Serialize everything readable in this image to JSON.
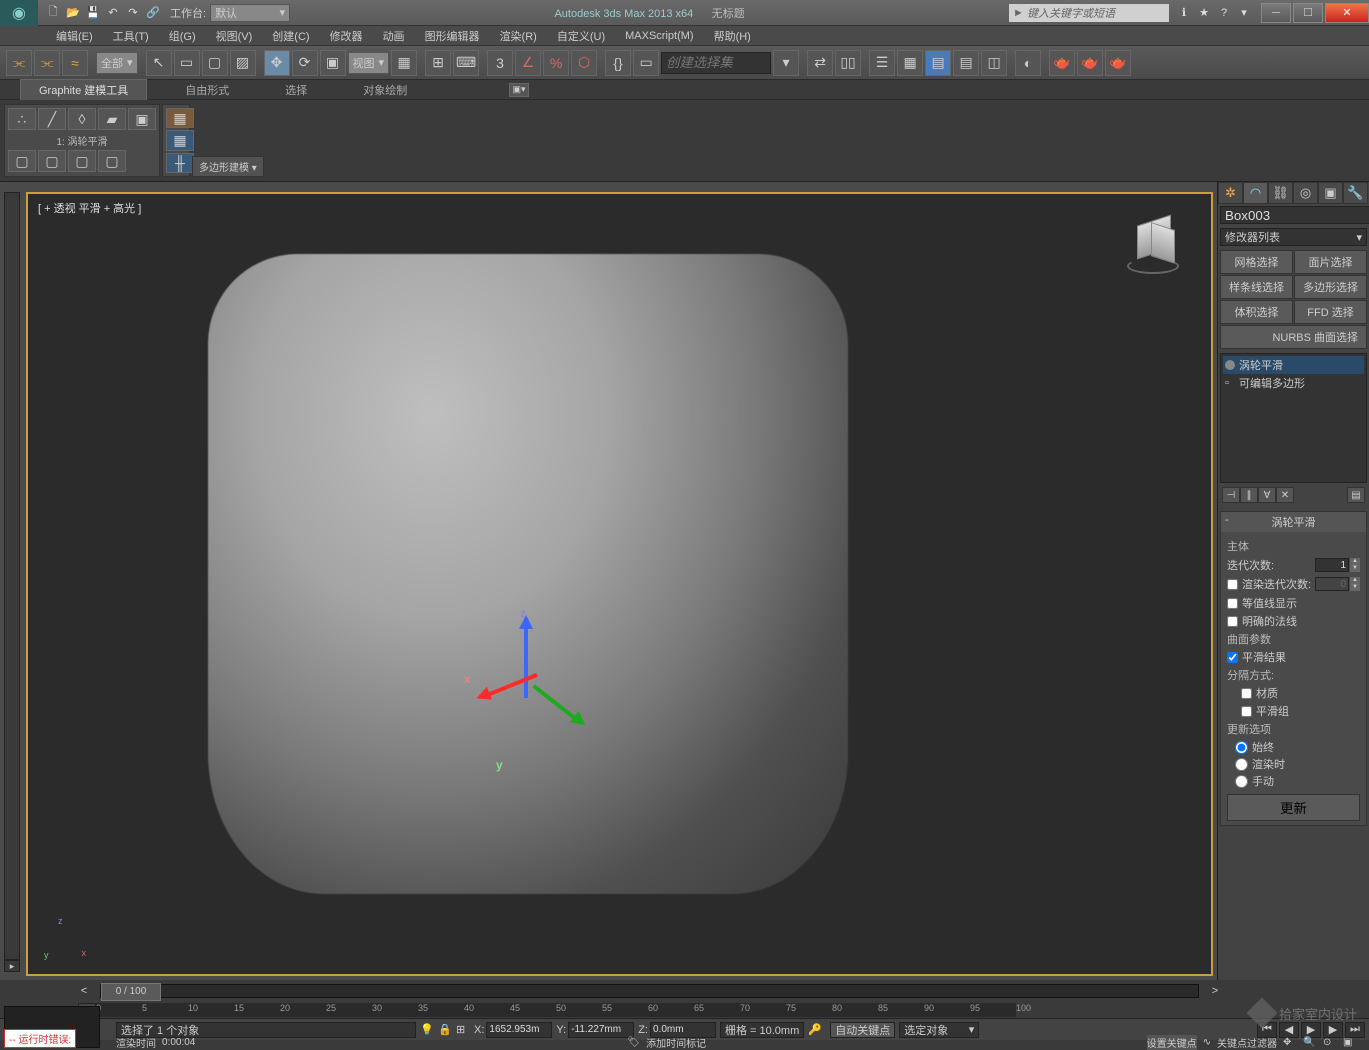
{
  "titlebar": {
    "workspace_label": "工作台:",
    "workspace_value": "默认",
    "app_name": "Autodesk 3ds Max  2013 x64",
    "doc_name": "无标题",
    "search_placeholder": "键入关键字或短语"
  },
  "menu": [
    "编辑(E)",
    "工具(T)",
    "组(G)",
    "视图(V)",
    "创建(C)",
    "修改器",
    "动画",
    "图形编辑器",
    "渲染(R)",
    "自定义(U)",
    "MAXScript(M)",
    "帮助(H)"
  ],
  "maintool": {
    "sel_filter": "全部",
    "ref_sys": "视图",
    "named_sel": "创建选择集"
  },
  "ribbon": {
    "tabs": [
      "Graphite 建模工具",
      "自由形式",
      "选择",
      "对象绘制"
    ],
    "preset_label": "1: 涡轮平滑",
    "footer": "多边形建模 ▾"
  },
  "viewport": {
    "label": "[ +  透视  平滑 + 高光 ]"
  },
  "cmd": {
    "object_name": "Box003",
    "modifier_list": "修改器列表",
    "sel_buttons": [
      "网格选择",
      "面片选择",
      "样条线选择",
      "多边形选择",
      "体积选择",
      "FFD 选择",
      "NURBS 曲面选择"
    ],
    "stack": [
      "涡轮平滑",
      "可编辑多边形"
    ],
    "rollout_title": "涡轮平滑",
    "main_label": "主体",
    "iter_label": "迭代次数:",
    "iter_val": "1",
    "render_iter_label": "渲染迭代次数:",
    "render_iter_val": "0",
    "isoline": "等值线显示",
    "explicit": "明确的法线",
    "surface_label": "曲面参数",
    "smooth_result": "平滑结果",
    "sep_label": "分隔方式:",
    "sep_mat": "材质",
    "sep_smg": "平滑组",
    "update_label": "更新选项",
    "upd_always": "始终",
    "upd_render": "渲染时",
    "upd_manual": "手动",
    "update_btn": "更新"
  },
  "timeline": {
    "pos": "0 / 100",
    "ticks": [
      0,
      5,
      10,
      15,
      20,
      25,
      30,
      35,
      40,
      45,
      50,
      55,
      60,
      65,
      70,
      75,
      80,
      85,
      90,
      95,
      100
    ]
  },
  "status": {
    "sel_prompt": "选择了 1 个对象",
    "x": "1652.953m",
    "y": "-11.227mm",
    "z": "0.0mm",
    "grid": "栅格 = 10.0mm",
    "autokey": "自动关键点",
    "key_target": "选定对象",
    "add_time_tag": "添加时间标记",
    "render_time_label": "渲染时间",
    "render_time_val": "0:00:04",
    "error": "-- 运行时错误:",
    "set_key": "设置关键点",
    "key_filter": "关键点过滤器"
  },
  "watermark": "拾家室内设计"
}
